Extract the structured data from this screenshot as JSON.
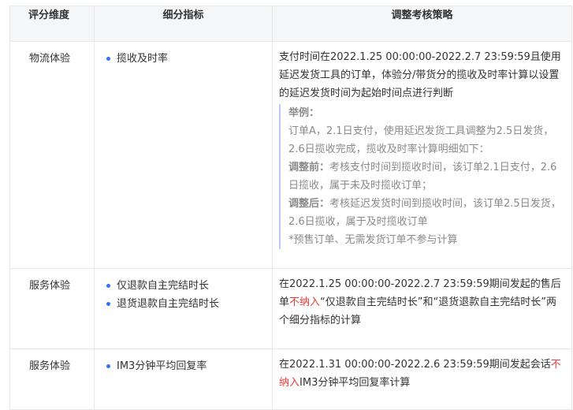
{
  "headers": {
    "dimension": "评分维度",
    "indicator": "细分指标",
    "policy": "调整考核策略"
  },
  "rows": [
    {
      "dimension": "物流体验",
      "indicators": [
        "揽收及时率"
      ],
      "policy": "支付时间在2022.1.25 00:00:00-2022.2.7 23:59:59且使用延迟发货工具的订单，体验分/带货分的揽收及时率计算以设置的延迟发货时间为起始时间点进行判断",
      "example": {
        "title": "举例：",
        "line1": "订单A，2.1日支付，使用延迟发货工具调整为2.5日发货，2.6日揽收完成，揽收及时率计算明细如下：",
        "before_label": "调整前：",
        "before_text": "考核支付时间到揽收时间，该订单2.1日支付，2.6日揽收，属于未及时揽收订单；",
        "after_label": "调整后：",
        "after_text": "考核延迟发货时间到揽收时间，该订单2.5日发货，2.6日揽收，属于及时揽收订单",
        "note": "*预售订单、无需发货订单不参与计算"
      }
    },
    {
      "dimension": "服务体验",
      "indicators": [
        "仅退款自主完结时长",
        "退货退款自主完结时长"
      ],
      "policy_pre": "在2022.1.25 00:00:00-2022.2.7 23:59:59期间发起的售后单",
      "policy_red": "不纳入",
      "policy_post": "“仅退款自主完结时长”和“退货退款自主完结时长”两个细分指标的计算"
    },
    {
      "dimension": "服务体验",
      "indicators": [
        "IM3分钟平均回复率"
      ],
      "policy_pre": "在2022.1.31 00:00:00-2022.2.6 23:59:59期间发起会话",
      "policy_red": "不纳入",
      "policy_post": "IM3分钟平均回复率计算"
    }
  ],
  "colors": {
    "accent": "#3370ff",
    "highlight": "#e53c3c",
    "header_bg": "#f5f6f7",
    "quote_border": "#b9c8f4"
  }
}
